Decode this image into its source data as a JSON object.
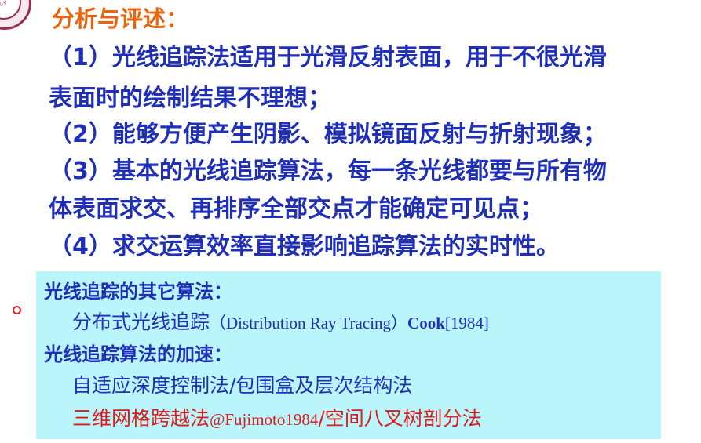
{
  "heading": "分析与评述：",
  "points": [
    "（1）光线追踪法适用于光滑反射表面，用于不很光滑",
    "表面时的绘制结果不理想；",
    "（2）能够方便产生阴影、模拟镜面反射与折射现象；",
    "（3）基本的光线追踪算法，每一条光线都要与所有物",
    "体表面求交、再排序全部交点才能确定可见点；",
    "（4）求交运算效率直接影响追踪算法的实时性。"
  ],
  "panel": {
    "other_title": "光线追踪的其它算法：",
    "distributed": {
      "cn": "分布式光线追踪",
      "en": "（Distribution Ray Tracing）",
      "author": "Cook",
      "year": "[1984]"
    },
    "accel_title": "光线追踪算法的加速：",
    "adaptive": "自适应深度控制法/包围盒及层次结构法",
    "grid": {
      "cn1": "三维网格跨越法",
      "ref": "@Fujimoto1984",
      "cn2": "/空间八叉树剖分法"
    }
  },
  "logo_text": "ONG UNIV"
}
